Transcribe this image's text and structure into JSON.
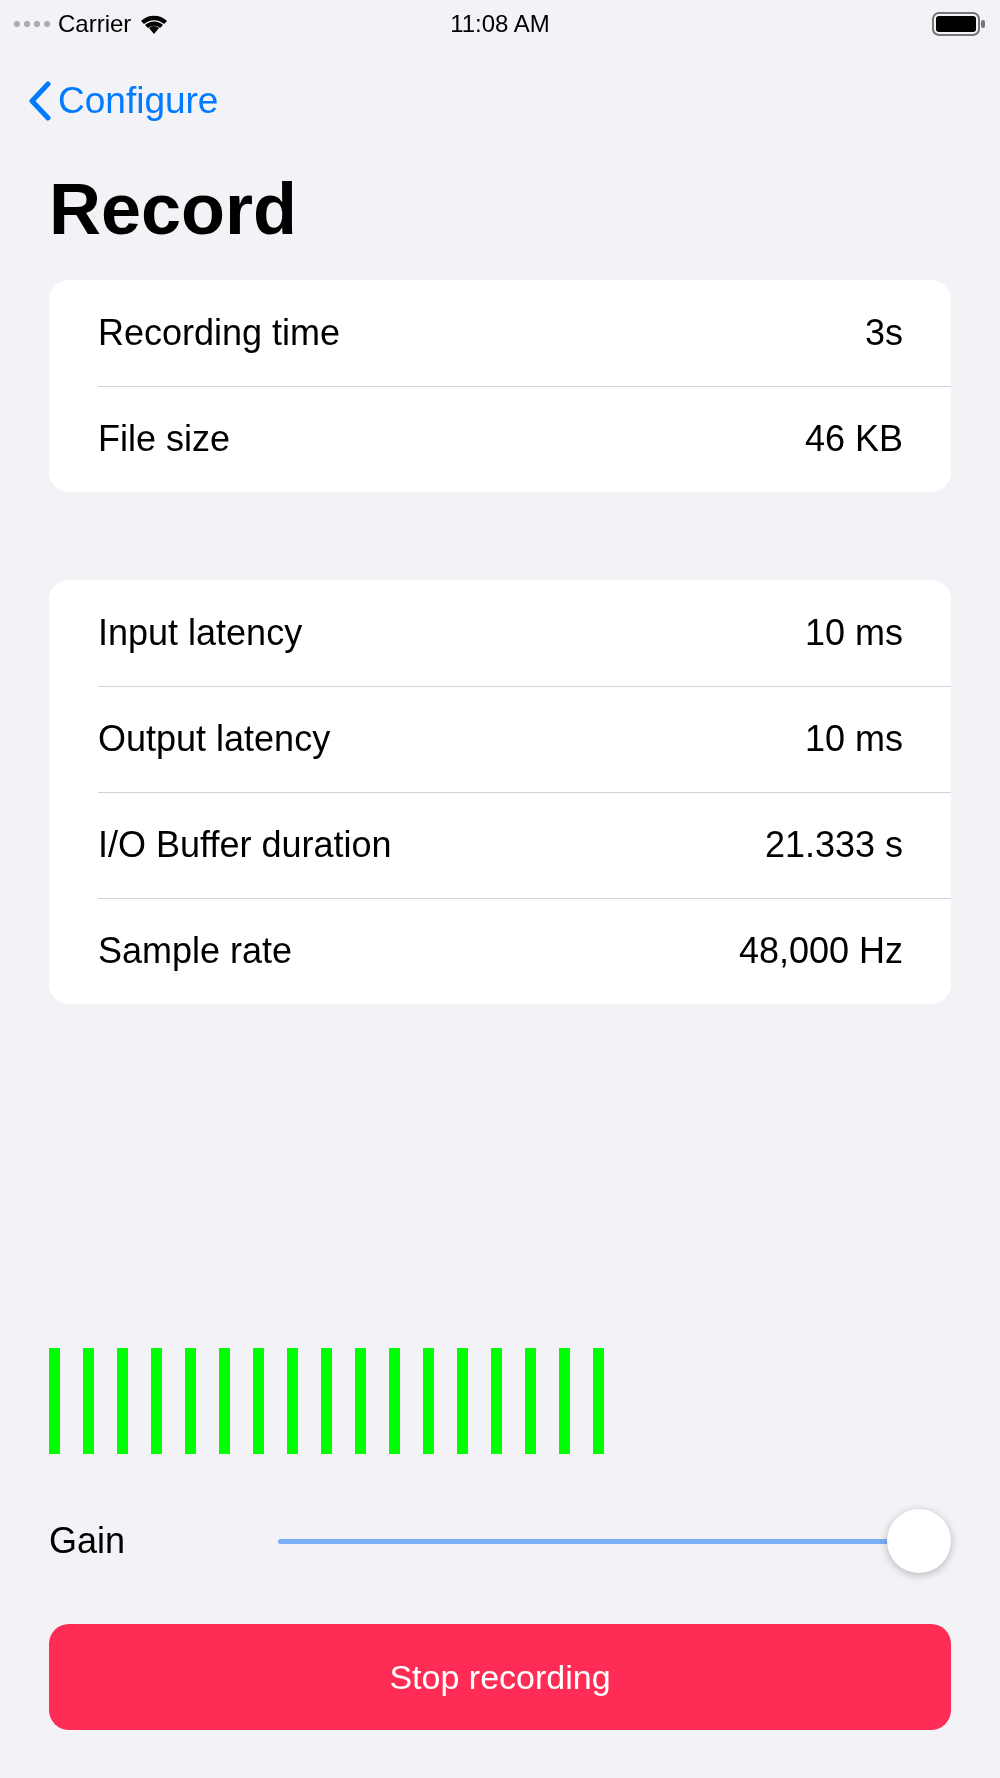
{
  "status_bar": {
    "carrier": "Carrier",
    "time": "11:08 AM"
  },
  "nav": {
    "back": "Configure"
  },
  "title": "Record",
  "sections": [
    {
      "rows": [
        {
          "label": "Recording time",
          "value": "3s"
        },
        {
          "label": "File size",
          "value": "46 KB"
        }
      ]
    },
    {
      "rows": [
        {
          "label": "Input latency",
          "value": "10 ms"
        },
        {
          "label": "Output latency",
          "value": "10 ms"
        },
        {
          "label": "I/O Buffer duration",
          "value": "21.333 s"
        },
        {
          "label": "Sample rate",
          "value": "48,000 Hz"
        }
      ]
    }
  ],
  "gain": {
    "label": "Gain",
    "level": 1
  },
  "button": "Stop recording"
}
